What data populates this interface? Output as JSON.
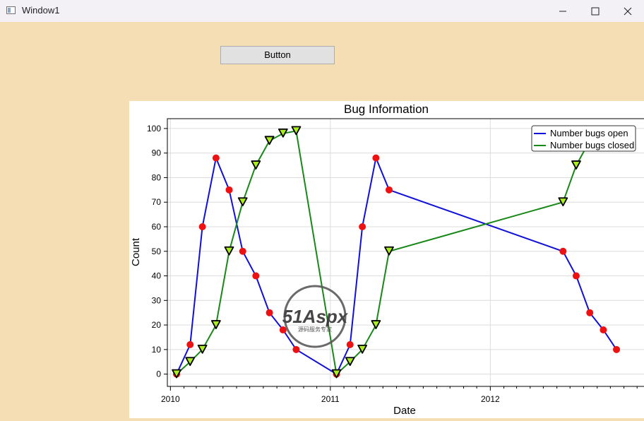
{
  "window": {
    "title": "Window1",
    "minimize_icon": "minimize-icon",
    "maximize_icon": "maximize-icon",
    "close_icon": "close-icon",
    "background": "#f5deb3"
  },
  "button": {
    "label": "Button"
  },
  "watermark": {
    "brand": "51Aspx",
    "tagline": "源码服务专家"
  },
  "chart_data": {
    "type": "line",
    "title": "Bug Information",
    "xlabel": "Date",
    "ylabel": "Count",
    "x_ticks": [
      "2010",
      "2011",
      "2012"
    ],
    "xlim": [
      "2009-12-25",
      "2012-12-20"
    ],
    "ylim": [
      -5,
      104
    ],
    "y_ticks": [
      0,
      10,
      20,
      30,
      40,
      50,
      60,
      70,
      80,
      90,
      100
    ],
    "grid": true,
    "legend_position": "top-right",
    "series": [
      {
        "name": "Number bugs open",
        "color": "#1010d8",
        "marker": "circle",
        "marker_color": "#ee1111",
        "points": [
          [
            "2010-01-15",
            0
          ],
          [
            "2010-02-15",
            12
          ],
          [
            "2010-03-15",
            60
          ],
          [
            "2010-04-15",
            88
          ],
          [
            "2010-05-15",
            75
          ],
          [
            "2010-06-15",
            50
          ],
          [
            "2010-07-15",
            40
          ],
          [
            "2010-08-15",
            25
          ],
          [
            "2010-09-15",
            18
          ],
          [
            "2010-10-15",
            10
          ],
          [
            "2011-01-15",
            0
          ],
          [
            "2011-02-15",
            12
          ],
          [
            "2011-03-15",
            60
          ],
          [
            "2011-04-15",
            88
          ],
          [
            "2011-05-15",
            75
          ],
          [
            "2012-06-15",
            50
          ],
          [
            "2012-07-15",
            40
          ],
          [
            "2012-08-15",
            25
          ],
          [
            "2012-09-15",
            18
          ],
          [
            "2012-10-15",
            10
          ]
        ]
      },
      {
        "name": "Number bugs closed",
        "color": "#188818",
        "marker": "triangle-down",
        "marker_color": "#aaee22",
        "points": [
          [
            "2010-01-15",
            0
          ],
          [
            "2010-02-15",
            5
          ],
          [
            "2010-03-15",
            10
          ],
          [
            "2010-04-15",
            20
          ],
          [
            "2010-05-15",
            50
          ],
          [
            "2010-06-15",
            70
          ],
          [
            "2010-07-15",
            85
          ],
          [
            "2010-08-15",
            95
          ],
          [
            "2010-09-15",
            98
          ],
          [
            "2010-10-15",
            99
          ],
          [
            "2011-01-15",
            0
          ],
          [
            "2011-02-15",
            5
          ],
          [
            "2011-03-15",
            10
          ],
          [
            "2011-04-15",
            20
          ],
          [
            "2011-05-15",
            50
          ],
          [
            "2012-06-15",
            70
          ],
          [
            "2012-07-15",
            85
          ],
          [
            "2012-08-15",
            95
          ],
          [
            "2012-09-15",
            98
          ],
          [
            "2012-10-15",
            99
          ]
        ]
      }
    ]
  }
}
